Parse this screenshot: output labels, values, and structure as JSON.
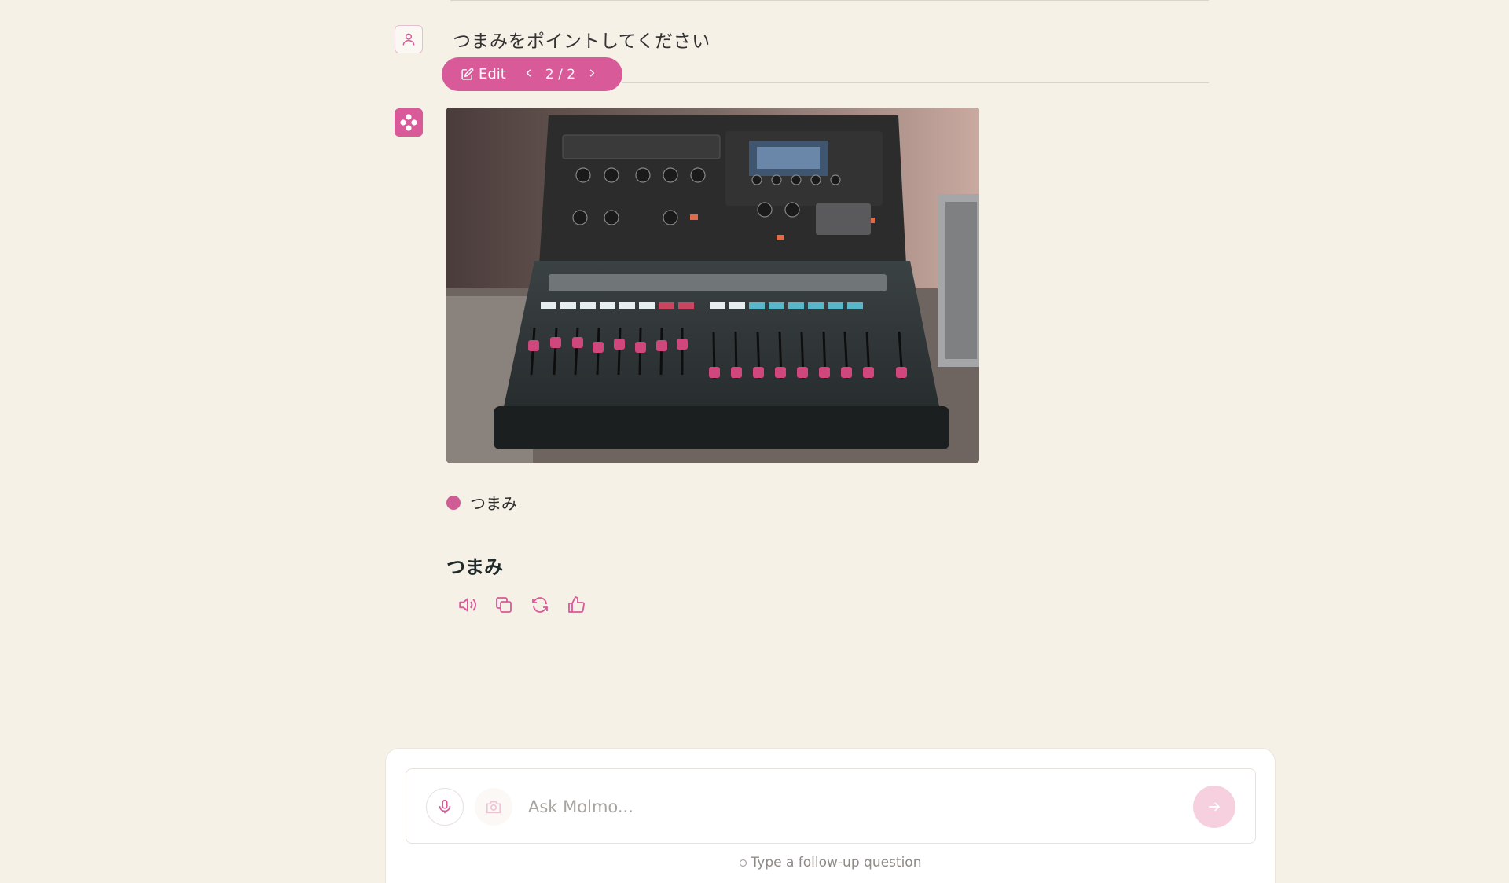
{
  "conversation": {
    "user_message": "つまみをポイントしてください",
    "edit_label": "Edit",
    "version_counter": "2 / 2",
    "legend_label": "つまみ",
    "answer_text": "つまみ"
  },
  "actions": [
    {
      "name": "speaker-icon"
    },
    {
      "name": "copy-icon"
    },
    {
      "name": "regenerate-icon"
    },
    {
      "name": "thumbs-up-icon"
    }
  ],
  "composer": {
    "placeholder": "Ask Molmo...",
    "hint": "Type a follow-up question"
  },
  "colors": {
    "accent": "#d85a98",
    "legend_dot": "#cf5c94",
    "background": "#f6f1e7"
  }
}
